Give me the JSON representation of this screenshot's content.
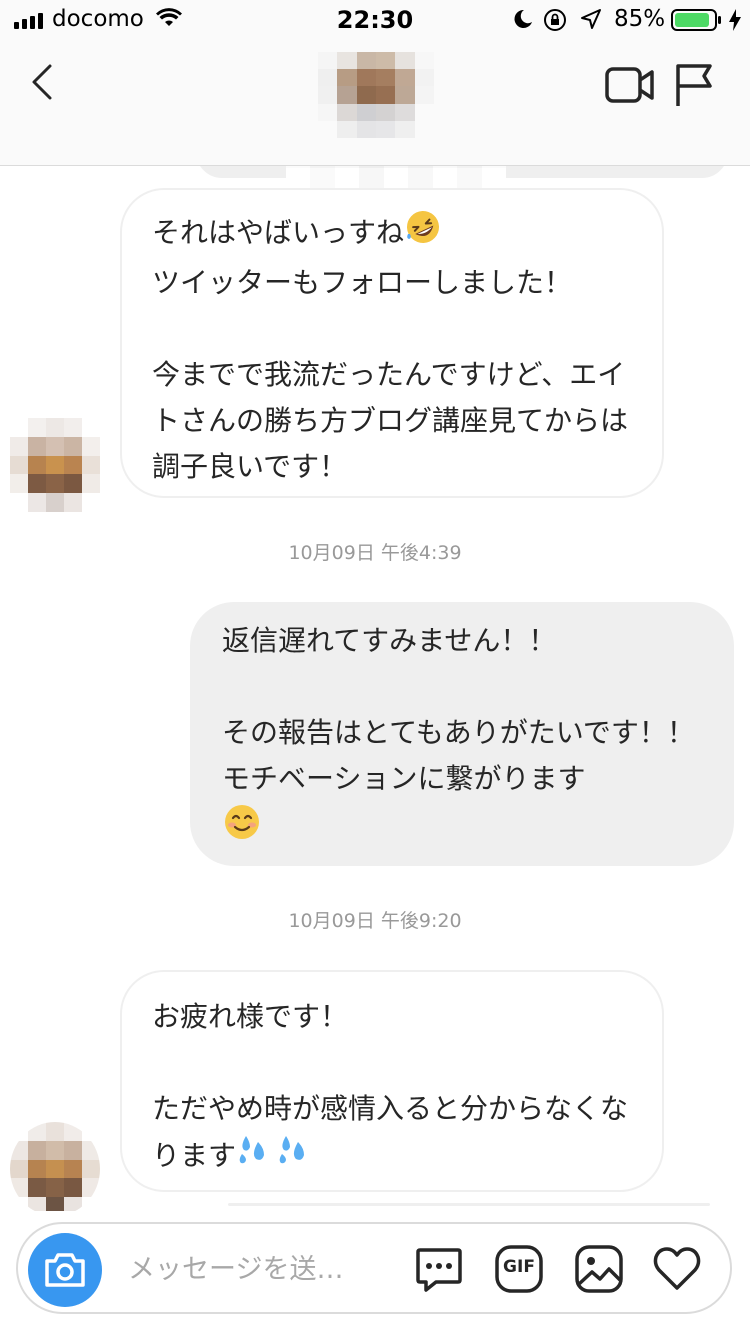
{
  "status_bar": {
    "carrier": "docomo",
    "time": "22:30",
    "battery": "85%"
  },
  "colors": {
    "bubble_outgoing": "#efefef",
    "bubble_incoming_border": "#efefef",
    "accent": "#3897f0",
    "battery": "#4cd964",
    "timestamp": "#999999"
  },
  "header": {
    "back_icon": "chevron-left-icon",
    "video_icon": "video-camera-icon",
    "flag_icon": "flag-icon"
  },
  "messages": [
    {
      "type": "in",
      "text": "それはやばいっすね",
      "emoji": "rolling-laughing-emoji",
      "text2": "\nツイッターもフォローしました！\n\n今までで我流だったんですけど、エイトさんの勝ち方ブログ講座見てからは調子良いです！"
    },
    {
      "type": "timestamp",
      "text": "10月09日 午後4:39"
    },
    {
      "type": "out",
      "text": "返信遅れてすみません！！\n\nその報告はとてもありがたいです！！モチベーションに繋がります"
    },
    {
      "type": "timestamp",
      "text": "10月09日 午後9:20"
    },
    {
      "type": "in",
      "text": "お疲れ様です！\n\nただやめ時が感情入ると分からなくなります"
    }
  ],
  "composer": {
    "placeholder": "メッセージを送…",
    "camera_icon": "camera-icon",
    "chat_icon": "chat-bubble-icon",
    "gif_label": "GIF",
    "image_icon": "image-icon",
    "heart_icon": "heart-icon"
  }
}
